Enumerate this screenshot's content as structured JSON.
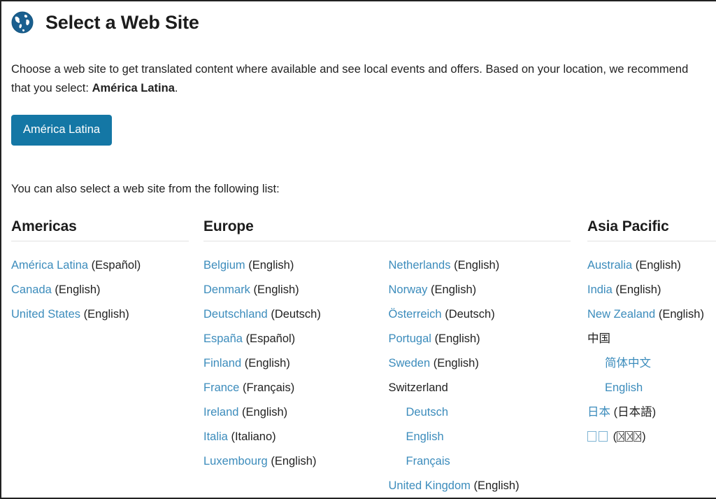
{
  "window": {
    "border_color": "#222222",
    "background": "#ffffff"
  },
  "header": {
    "icon": "globe-icon",
    "title": "Select a Web Site"
  },
  "intro": {
    "text_before": "Choose a web site to get translated content where available and see local events and offers. Based on your location, we recommend that you select: ",
    "recommended": "América Latina",
    "text_after": "."
  },
  "cta": {
    "label": "América Latina",
    "background": "#1477a5",
    "text_color": "#ffffff"
  },
  "list_lead": "You can also select a web site from the following list:",
  "colors": {
    "link": "#3c8cbc",
    "text": "#222222",
    "rule": "#e2e2e2"
  },
  "regions": [
    {
      "title": "Americas",
      "columns": [
        {
          "entries": [
            {
              "name": "América Latina",
              "link": true,
              "lang": "(Español)",
              "indent": false
            },
            {
              "name": "Canada",
              "link": true,
              "lang": "(English)",
              "indent": false
            },
            {
              "name": "United States",
              "link": true,
              "lang": "(English)",
              "indent": false
            }
          ]
        }
      ]
    },
    {
      "title": "Europe",
      "columns": [
        {
          "entries": [
            {
              "name": "Belgium",
              "link": true,
              "lang": "(English)",
              "indent": false
            },
            {
              "name": "Denmark",
              "link": true,
              "lang": "(English)",
              "indent": false
            },
            {
              "name": "Deutschland",
              "link": true,
              "lang": "(Deutsch)",
              "indent": false
            },
            {
              "name": "España",
              "link": true,
              "lang": "(Español)",
              "indent": false
            },
            {
              "name": "Finland",
              "link": true,
              "lang": "(English)",
              "indent": false
            },
            {
              "name": "France",
              "link": true,
              "lang": "(Français)",
              "indent": false
            },
            {
              "name": "Ireland",
              "link": true,
              "lang": "(English)",
              "indent": false
            },
            {
              "name": "Italia",
              "link": true,
              "lang": "(Italiano)",
              "indent": false
            },
            {
              "name": "Luxembourg",
              "link": true,
              "lang": "(English)",
              "indent": false
            }
          ]
        },
        {
          "entries": [
            {
              "name": "Netherlands",
              "link": true,
              "lang": "(English)",
              "indent": false
            },
            {
              "name": "Norway",
              "link": true,
              "lang": "(English)",
              "indent": false
            },
            {
              "name": "Österreich",
              "link": true,
              "lang": "(Deutsch)",
              "indent": false
            },
            {
              "name": "Portugal",
              "link": true,
              "lang": "(English)",
              "indent": false
            },
            {
              "name": "Sweden",
              "link": true,
              "lang": "(English)",
              "indent": false
            },
            {
              "name": "Switzerland",
              "link": false,
              "lang": "",
              "indent": false
            },
            {
              "name": "Deutsch",
              "link": true,
              "lang": "",
              "indent": true
            },
            {
              "name": "English",
              "link": true,
              "lang": "",
              "indent": true
            },
            {
              "name": "Français",
              "link": true,
              "lang": "",
              "indent": true
            },
            {
              "name": "United Kingdom",
              "link": true,
              "lang": "(English)",
              "indent": false
            }
          ]
        }
      ]
    },
    {
      "title": "Asia Pacific",
      "columns": [
        {
          "entries": [
            {
              "name": "Australia",
              "link": true,
              "lang": "(English)",
              "indent": false
            },
            {
              "name": "India",
              "link": true,
              "lang": "(English)",
              "indent": false
            },
            {
              "name": "New Zealand",
              "link": true,
              "lang": "(English)",
              "indent": false
            },
            {
              "name": "中国",
              "link": false,
              "lang": "",
              "indent": false
            },
            {
              "name": "简体中文",
              "link": true,
              "lang": "",
              "indent": true
            },
            {
              "name": "English",
              "link": true,
              "lang": "",
              "indent": true
            },
            {
              "name": "日本",
              "link": true,
              "lang": "(日本語)",
              "indent": false
            },
            {
              "name": "□□",
              "link": true,
              "lang": "(▨▨▨)",
              "indent": false,
              "missing_glyphs": true
            }
          ]
        }
      ]
    }
  ]
}
